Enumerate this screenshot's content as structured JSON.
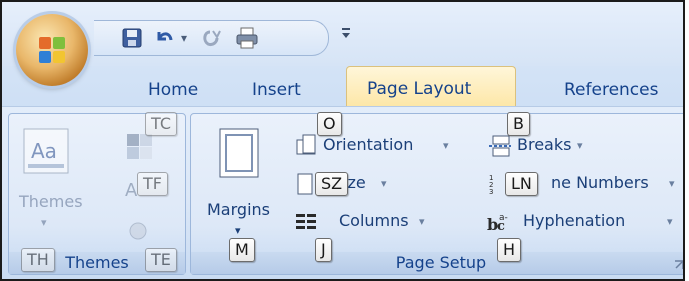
{
  "tabs": [
    "Home",
    "Insert",
    "Page Layout",
    "References"
  ],
  "active_tab": "Page Layout",
  "qat": {
    "more": "⬇"
  },
  "groups": {
    "themes": {
      "label": "Themes",
      "themes_button": "Themes"
    },
    "page_setup": {
      "label": "Page Setup",
      "margins": "Margins",
      "orientation": "Orientation",
      "size": "ize",
      "columns": "Columns",
      "breaks": "Breaks",
      "line_numbers": "ne Numbers",
      "hyphenation": "Hyphenation"
    }
  },
  "dropdown_arrow": "▾",
  "keytips": {
    "TC": "TC",
    "TF": "TF",
    "TE": "TE",
    "TH": "TH",
    "O": "O",
    "SZ": "SZ",
    "J": "J",
    "M": "M",
    "B": "B",
    "LN": "LN",
    "H": "H"
  },
  "colors": {
    "accent_text": "#15428b",
    "active_tab": "#fde7a8",
    "ribbon": "#dbe7f7"
  }
}
